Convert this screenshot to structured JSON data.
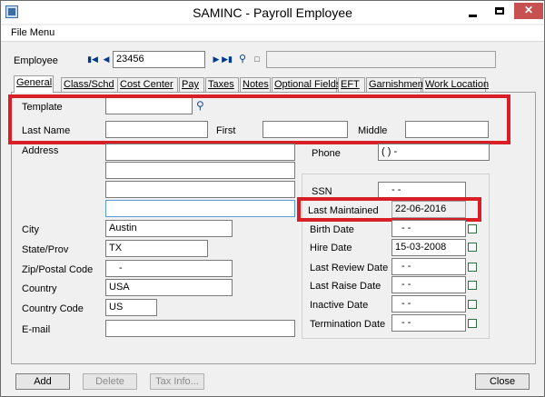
{
  "window": {
    "title": "SAMINC - Payroll Employee"
  },
  "menu": {
    "file": "File Menu"
  },
  "employee": {
    "label": "Employee",
    "id": "23456",
    "name": ""
  },
  "tabs": [
    "General",
    "Class/Schd",
    "Cost Center",
    "Pay",
    "Taxes",
    "Notes",
    "Optional Fields",
    "EFT",
    "Garnishment",
    "Work Location"
  ],
  "name_section": {
    "template_label": "Template",
    "template_value": "",
    "last_name_label": "Last Name",
    "last_name_value": "",
    "first_label": "First",
    "first_value": "",
    "middle_label": "Middle",
    "middle_value": ""
  },
  "address": {
    "label": "Address",
    "line1": "",
    "line2": "",
    "line3": "",
    "line4": ""
  },
  "city": {
    "label": "City",
    "value": "Austin"
  },
  "state": {
    "label": "State/Prov",
    "value": "TX"
  },
  "zip": {
    "label": "Zip/Postal Code",
    "value": "-"
  },
  "country": {
    "label": "Country",
    "value": "USA"
  },
  "country_code": {
    "label": "Country Code",
    "value": "US"
  },
  "email": {
    "label": "E-mail",
    "value": ""
  },
  "phone": {
    "label": "Phone",
    "value": "(    )     -"
  },
  "ssn": {
    "label": "SSN",
    "value": "-   -"
  },
  "last_maintained": {
    "label": "Last Maintained",
    "value": "22-06-2016"
  },
  "birth_date": {
    "label": "Birth Date",
    "value": "-   -"
  },
  "hire_date": {
    "label": "Hire Date",
    "value": "15-03-2008"
  },
  "last_review_date": {
    "label": "Last Review Date",
    "value": "-   -"
  },
  "last_raise_date": {
    "label": "Last Raise Date",
    "value": "-   -"
  },
  "inactive_date": {
    "label": "Inactive Date",
    "value": "-   -"
  },
  "termination_date": {
    "label": "Termination Date",
    "value": "-   -"
  },
  "buttons": {
    "add": "Add",
    "delete": "Delete",
    "tax_info": "Tax Info...",
    "close": "Close"
  },
  "colors": {
    "highlight": "#d81f26",
    "nav_arrows": "#003a8c"
  }
}
